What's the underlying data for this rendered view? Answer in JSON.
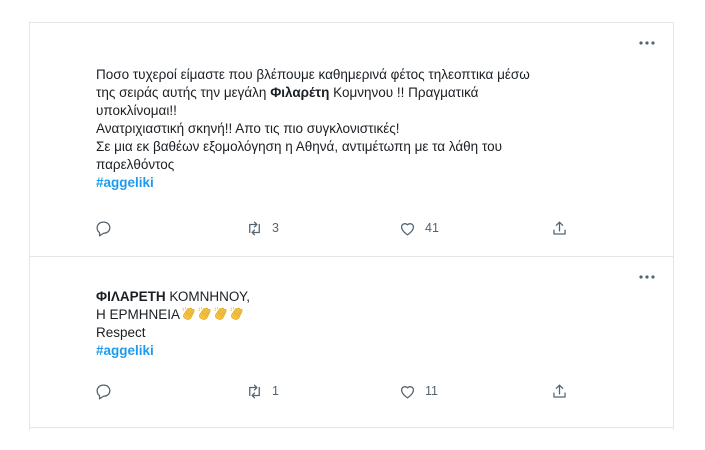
{
  "tweets": [
    {
      "lines": [
        {
          "before": "Ποσο τυχεροί είμαστε που βλέπουμε καθημερινά φέτος τηλεοπτικα μέσω",
          "bold": "",
          "after": ""
        },
        {
          "before": "της σειράς αυτής την μεγάλη ",
          "bold": "Φιλαρέτη",
          "after": " Κομνηνου !! Πραγματικά"
        },
        {
          "before": "υποκλίνομαι!!",
          "bold": "",
          "after": ""
        },
        {
          "before": "Ανατριχιαστική σκηνή!! Απο τις πιο συγκλονιστικές!",
          "bold": "",
          "after": ""
        },
        {
          "before": "Σε μια εκ βαθέων εξομολόγηση η Αθηνά, αντιμέτωπη με τα λάθη του",
          "bold": "",
          "after": ""
        },
        {
          "before": "παρελθόντος",
          "bold": "",
          "after": ""
        }
      ],
      "hashtag": "#aggeliki",
      "reply_icon": "reply-icon",
      "retweet_icon": "retweet-icon",
      "retweet_count": "3",
      "like_icon": "heart-icon",
      "like_count": "41",
      "share_icon": "share-icon"
    },
    {
      "lines": [
        {
          "before": "",
          "bold": "ΦΙΛΑΡΕΤΗ",
          "after": " ΚΟΜΝΗΝΟΥ,"
        },
        {
          "before": "Η ΕΡΜΗΝΕΙΑ",
          "bold": "",
          "after": ""
        },
        {
          "before": "Respect",
          "bold": "",
          "after": ""
        }
      ],
      "emoji_icon": "clapping-hands-icon",
      "emoji_count": 4,
      "hashtag": "#aggeliki",
      "retweet_count": "1",
      "like_count": "11"
    }
  ],
  "colors": {
    "accent": "#1d9bf0",
    "muted": "#536471",
    "emoji": "#f6c443",
    "border": "#e3e7ea"
  }
}
